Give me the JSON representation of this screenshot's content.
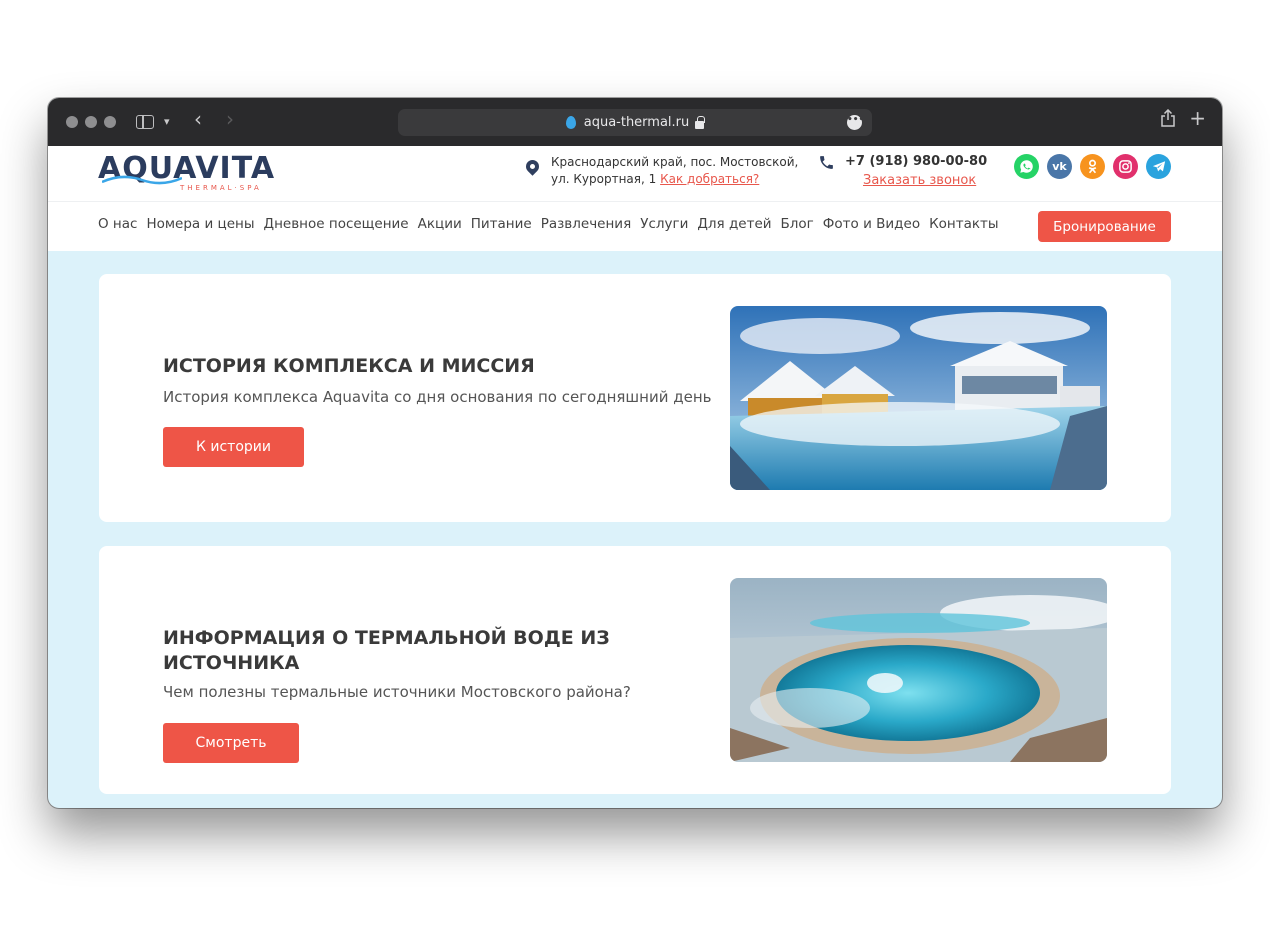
{
  "browser": {
    "url": "aqua-thermal.ru"
  },
  "header": {
    "logo_text": "AQUAVITA",
    "logo_subtitle": "THERMAL·SPA",
    "address_line1": "Краснодарский край, пос. Мостовской,",
    "address_line2": "ул. Курортная, 1",
    "directions_link": "Как добраться?",
    "phone": "+7 (918) 980-00-80",
    "callback_link": "Заказать звонок",
    "socials": [
      {
        "name": "whatsapp-icon",
        "color": "#25d366"
      },
      {
        "name": "vk-icon",
        "color": "#4a76a8"
      },
      {
        "name": "odnoklassniki-icon",
        "color": "#f7931e"
      },
      {
        "name": "instagram-icon",
        "color": "#e1306c"
      },
      {
        "name": "telegram-icon",
        "color": "#2aa3de"
      }
    ]
  },
  "nav": {
    "items": [
      "О нас",
      "Номера и цены",
      "Дневное посещение",
      "Акции",
      "Питание",
      "Развлечения",
      "Услуги",
      "Для детей",
      "Блог",
      "Фото и Видео",
      "Контакты"
    ],
    "booking_button": "Бронирование"
  },
  "cards": [
    {
      "title": "ИСТОРИЯ КОМПЛЕКСА И МИССИЯ",
      "description": "История комплекса Aquavita со дня основания по сегодняшний день",
      "button": "К истории"
    },
    {
      "title_line1": "ИНФОРМАЦИЯ О ТЕРМАЛЬНОЙ ВОДЕ ИЗ",
      "title_line2": "ИСТОЧНИКА",
      "description": "Чем полезны термальные источники Мостовского района?",
      "button": "Смотреть"
    }
  ],
  "colors": {
    "accent": "#ee5547",
    "brand_dark": "#2b3c5e",
    "page_bg": "#dcf2fa"
  }
}
